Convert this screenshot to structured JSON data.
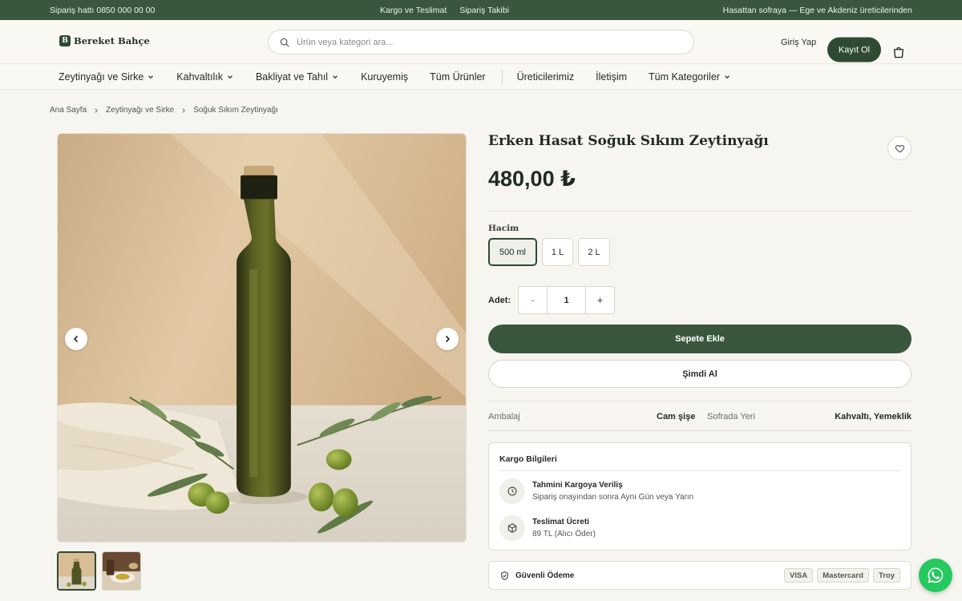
{
  "topbar": {
    "hotline": "Sipariş hattı 0850 000 00 00",
    "links": [
      "Kargo ve Teslimat",
      "Sipariş Takibi"
    ],
    "tagline": "Hasattan sofraya — Ege ve Akdeniz üreticilerinden"
  },
  "header": {
    "logo_mark": "B",
    "logo_text": "Bereket Bahçe",
    "search_placeholder": "Ürün veya kategori ara...",
    "login": "Giriş Yap",
    "register": "Kayıt Ol"
  },
  "nav": {
    "items": [
      "Zeytinyağı ve Sirke",
      "Kahvaltılık",
      "Bakliyat ve Tahıl",
      "Kuruyemiş",
      "Tüm Ürünler",
      "Üreticilerimiz",
      "İletişim",
      "Tüm Kategoriler"
    ]
  },
  "breadcrumb": [
    "Ana Sayfa",
    "Zeytinyağı ve Sirke",
    "Soğuk Sıkım Zeytinyağı"
  ],
  "product": {
    "title": "Erken Hasat Soğuk Sıkım Zeytinyağı",
    "price": "480,00 ₺",
    "volume_label": "Hacim",
    "volumes": [
      "500 ml",
      "1 L",
      "2 L"
    ],
    "selected_volume": "500 ml",
    "qty_label": "Adet:",
    "qty_minus": "-",
    "qty_value": "1",
    "qty_plus": "+",
    "add_to_cart": "Sepete Ekle",
    "buy_now": "Şimdi Al",
    "attributes": [
      {
        "key": "Ambalaj",
        "value": "Cam şişe"
      },
      {
        "key": "Sofrada Yeri",
        "value": "Kahvaltı, Yemeklik"
      }
    ]
  },
  "shipping": {
    "title": "Kargo Bilgileri",
    "rows": [
      {
        "heading": "Tahmini Kargoya Veriliş",
        "sub": "Sipariş onayından sonra Aynı Gün veya Yarın",
        "icon": "clock-icon"
      },
      {
        "heading": "Teslimat Ücreti",
        "sub": "89 TL (Alıcı Öder)",
        "icon": "box-icon"
      }
    ]
  },
  "payment": {
    "label": "Güvenli Ödeme",
    "cards": [
      "VISA",
      "Mastercard",
      "Troy"
    ]
  },
  "colors": {
    "brand_green": "#3a573d",
    "dark_green": "#2f4a33",
    "whatsapp": "#25c95f",
    "background": "#f7f5f0"
  }
}
